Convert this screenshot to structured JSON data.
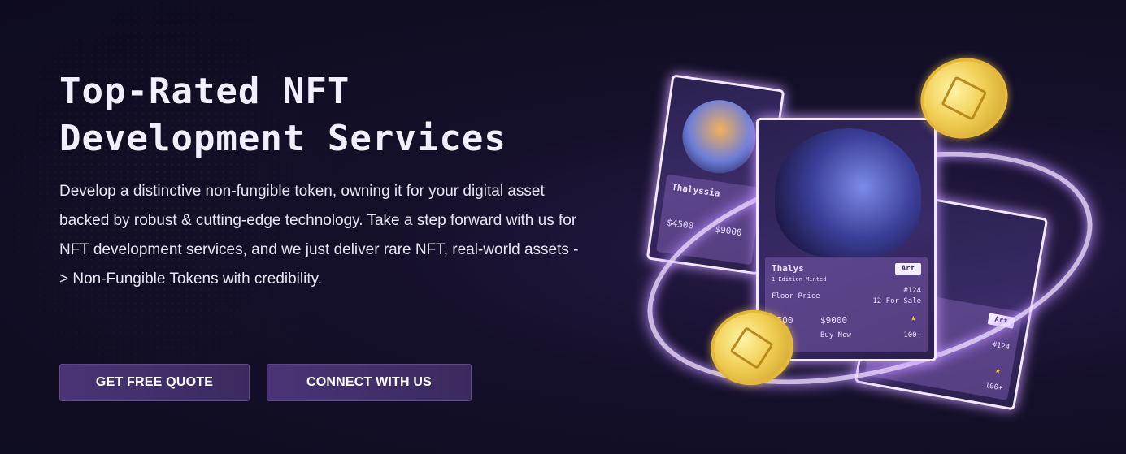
{
  "hero": {
    "title_line1": "Top-Rated NFT",
    "title_line2": "Development Services",
    "description": "Develop a distinctive non-fungible token, owning it for your digital asset backed by robust & cutting-edge technology. Take a step forward with us for NFT development services, and we just deliver rare NFT, real-world assets -> Non-Fungible Tokens with credibility."
  },
  "buttons": {
    "quote": "GET FREE QUOTE",
    "connect": "CONNECT WITH US"
  },
  "art": {
    "main_card": {
      "name": "Thalys",
      "subtitle": "1 Edition Minted",
      "tag": "Art",
      "floor_label": "Floor Price",
      "number": "#124",
      "for_sale": "12 For Sale",
      "price_a": "$500",
      "price_b": "$9000",
      "action": "Buy Now",
      "count": "100+"
    },
    "left_card": {
      "name": "Thalyssia",
      "price_a": "$4500",
      "price_b": "$9000"
    },
    "right_card": {
      "tag": "Art",
      "number": "#124",
      "count": "100+"
    },
    "colors": {
      "coin": "#f1cf55",
      "glow": "#c79bff",
      "button_bg": "#4a3476"
    }
  }
}
